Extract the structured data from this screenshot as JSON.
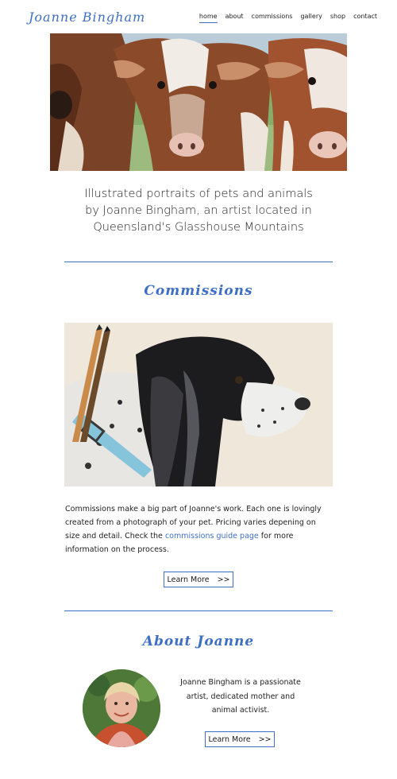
{
  "header": {
    "logo": "Joanne Bingham",
    "nav": [
      {
        "label": "home",
        "active": true
      },
      {
        "label": "about",
        "active": false
      },
      {
        "label": "commissions",
        "active": false
      },
      {
        "label": "gallery",
        "active": false
      },
      {
        "label": "shop",
        "active": false
      },
      {
        "label": "contact",
        "active": false
      }
    ]
  },
  "intro": {
    "line1": "Illustrated portraits of pets and animals",
    "line2": "by Joanne Bingham, an artist located in",
    "line3": "Queensland's Glasshouse Mountains"
  },
  "commissions": {
    "title": "Commissions",
    "text_before": "Commissions make a big part of Joanne's work. Each one is lovingly created from a photograph of your pet. Pricing varies depening on size and detail. Check the ",
    "link": "commissions guide page",
    "text_after": " for more information on the process.",
    "button": "Learn More",
    "button_arrows": ">>"
  },
  "about": {
    "title": "About Joanne",
    "text": "Joanne Bingham is a passionate artist, dedicated mother and animal activist.",
    "button": "Learn More",
    "button_arrows": ">>"
  },
  "colors": {
    "accent": "#3e6fc4"
  }
}
